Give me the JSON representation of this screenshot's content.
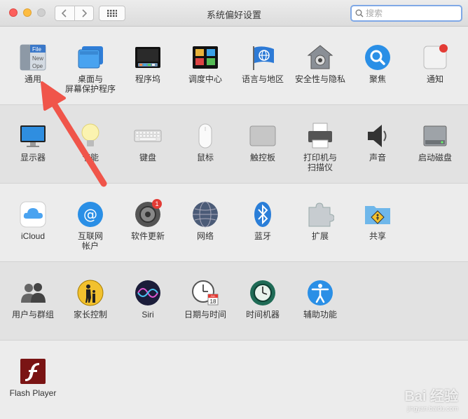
{
  "window": {
    "title": "系统偏好设置",
    "search_placeholder": "搜索"
  },
  "rows": [
    {
      "items": [
        {
          "label": "通用",
          "icon": "general-icon"
        },
        {
          "label": "桌面与\n屏幕保护程序",
          "icon": "desktop-icon"
        },
        {
          "label": "程序坞",
          "icon": "dock-icon"
        },
        {
          "label": "调度中心",
          "icon": "mission-control-icon"
        },
        {
          "label": "语言与地区",
          "icon": "language-region-icon"
        },
        {
          "label": "安全性与隐私",
          "icon": "security-icon"
        },
        {
          "label": "聚焦",
          "icon": "spotlight-icon"
        },
        {
          "label": "通知",
          "icon": "notifications-icon"
        }
      ]
    },
    {
      "items": [
        {
          "label": "显示器",
          "icon": "displays-icon"
        },
        {
          "label": "节能",
          "icon": "energy-saver-icon"
        },
        {
          "label": "键盘",
          "icon": "keyboard-icon"
        },
        {
          "label": "鼠标",
          "icon": "mouse-icon"
        },
        {
          "label": "触控板",
          "icon": "trackpad-icon"
        },
        {
          "label": "打印机与\n扫描仪",
          "icon": "printer-icon"
        },
        {
          "label": "声音",
          "icon": "sound-icon"
        },
        {
          "label": "启动磁盘",
          "icon": "startup-disk-icon"
        }
      ]
    },
    {
      "items": [
        {
          "label": "iCloud",
          "icon": "icloud-icon"
        },
        {
          "label": "互联网\n帐户",
          "icon": "internet-accounts-icon"
        },
        {
          "label": "软件更新",
          "icon": "software-update-icon",
          "badge": "1"
        },
        {
          "label": "网络",
          "icon": "network-icon"
        },
        {
          "label": "蓝牙",
          "icon": "bluetooth-icon"
        },
        {
          "label": "扩展",
          "icon": "extensions-icon"
        },
        {
          "label": "共享",
          "icon": "sharing-icon"
        }
      ]
    },
    {
      "items": [
        {
          "label": "用户与群组",
          "icon": "users-groups-icon"
        },
        {
          "label": "家长控制",
          "icon": "parental-controls-icon"
        },
        {
          "label": "Siri",
          "icon": "siri-icon"
        },
        {
          "label": "日期与时间",
          "icon": "date-time-icon"
        },
        {
          "label": "时间机器",
          "icon": "time-machine-icon"
        },
        {
          "label": "辅助功能",
          "icon": "accessibility-icon"
        }
      ]
    },
    {
      "items": [
        {
          "label": "Flash Player",
          "icon": "flash-player-icon"
        }
      ]
    }
  ],
  "icon_text": {
    "general_file": "File",
    "general_new": "New",
    "general_ope": "Ope",
    "calendar_month": "JUL",
    "calendar_day": "18"
  },
  "watermark": {
    "brand": "Bai 经验",
    "url": "jingyan.baidu.com"
  },
  "colors": {
    "annotation_arrow": "#f0554a",
    "badge": "#e33b35",
    "search_focus": "#7fa8e6"
  }
}
